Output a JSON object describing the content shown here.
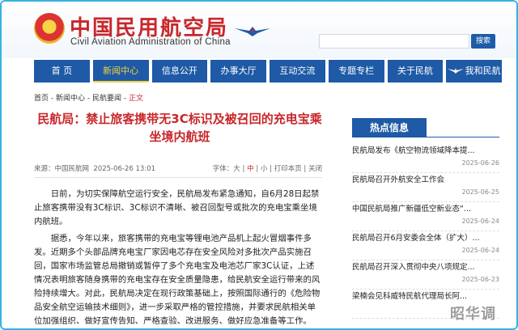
{
  "header": {
    "title": "中国民用航空局",
    "subtitle": "Civil Aviation Administration of China",
    "search_button": "搜索"
  },
  "nav": [
    {
      "label": "首 页"
    },
    {
      "label": "新闻中心"
    },
    {
      "label": "信息公开"
    },
    {
      "label": "办事大厅"
    },
    {
      "label": "互动交流"
    },
    {
      "label": "专题专栏"
    },
    {
      "label": "关于民航"
    },
    {
      "label": "我和民航"
    }
  ],
  "breadcrumb": {
    "home": "首页",
    "sep1": " - ",
    "news": "新闻中心",
    "sep2": " - ",
    "cat": "民航要闻",
    "sep3": " - ",
    "current": "正文"
  },
  "article": {
    "title": "民航局：禁止旅客携带无3C标识及被召回的充电宝乘坐境内航班",
    "source": "来源：中国民航网",
    "date": "2025-06-26 13:01",
    "font_label": "字体：",
    "font_big": "大",
    "font_mid": "中",
    "font_small": "小",
    "sep": "|",
    "print": "打印本页",
    "close": "关闭",
    "paragraphs": [
      "日前，为切实保障航空运行安全，民航局发布紧急通知，自6月28日起禁止旅客携带没有3C标识、3C标识不清晰、被召回型号或批次的充电宝乘坐境内航班。",
      "据悉，今年以来，旅客携带的充电宝等锂电池产品机上起火冒烟事件多发。近期多个头部品牌充电宝厂家因电芯存在安全风险对多批次产品实施召回，国家市场监管总局撤销或暂停了多个充电宝及电池芯厂家3C认证，上述情况表明旅客随身携带的充电宝存在安全质量隐患，给民航安全运行带来的风险持续增大。对此，民航局决定在现行政策基础上，按照国际通行的《危险物品安全航空运输技术细则》，进一步采取严格的管控措施，并要求民航相关单位加强组织、做好宣传告知、严格查验、改进服务、做好应急准备等工作。"
    ]
  },
  "sidebar": {
    "heading": "热点信息",
    "items": [
      {
        "title": "民航局发布《航空物流领域降本提...",
        "date": "2025-06-26"
      },
      {
        "title": "民航局召开外航安全工作会",
        "date": "2025-06-25"
      },
      {
        "title": "中国民航局推广新疆低空新业态“...",
        "date": "2025-06-24"
      },
      {
        "title": "民航局召开6月安委会全体（扩大）...",
        "date": "2025-06-24"
      },
      {
        "title": "民航局召开深入贯彻中央八项规定...",
        "date": "2025-06-23"
      },
      {
        "title": "梁楠会见科威特民航代理局长阿...",
        "date": ""
      }
    ]
  },
  "watermark": "昭华调",
  "colors": {
    "brand_red": "#c9272b",
    "nav_blue": "#1e5aa6",
    "accent_yellow": "#f4d13e",
    "frame": "#36b3e0"
  }
}
